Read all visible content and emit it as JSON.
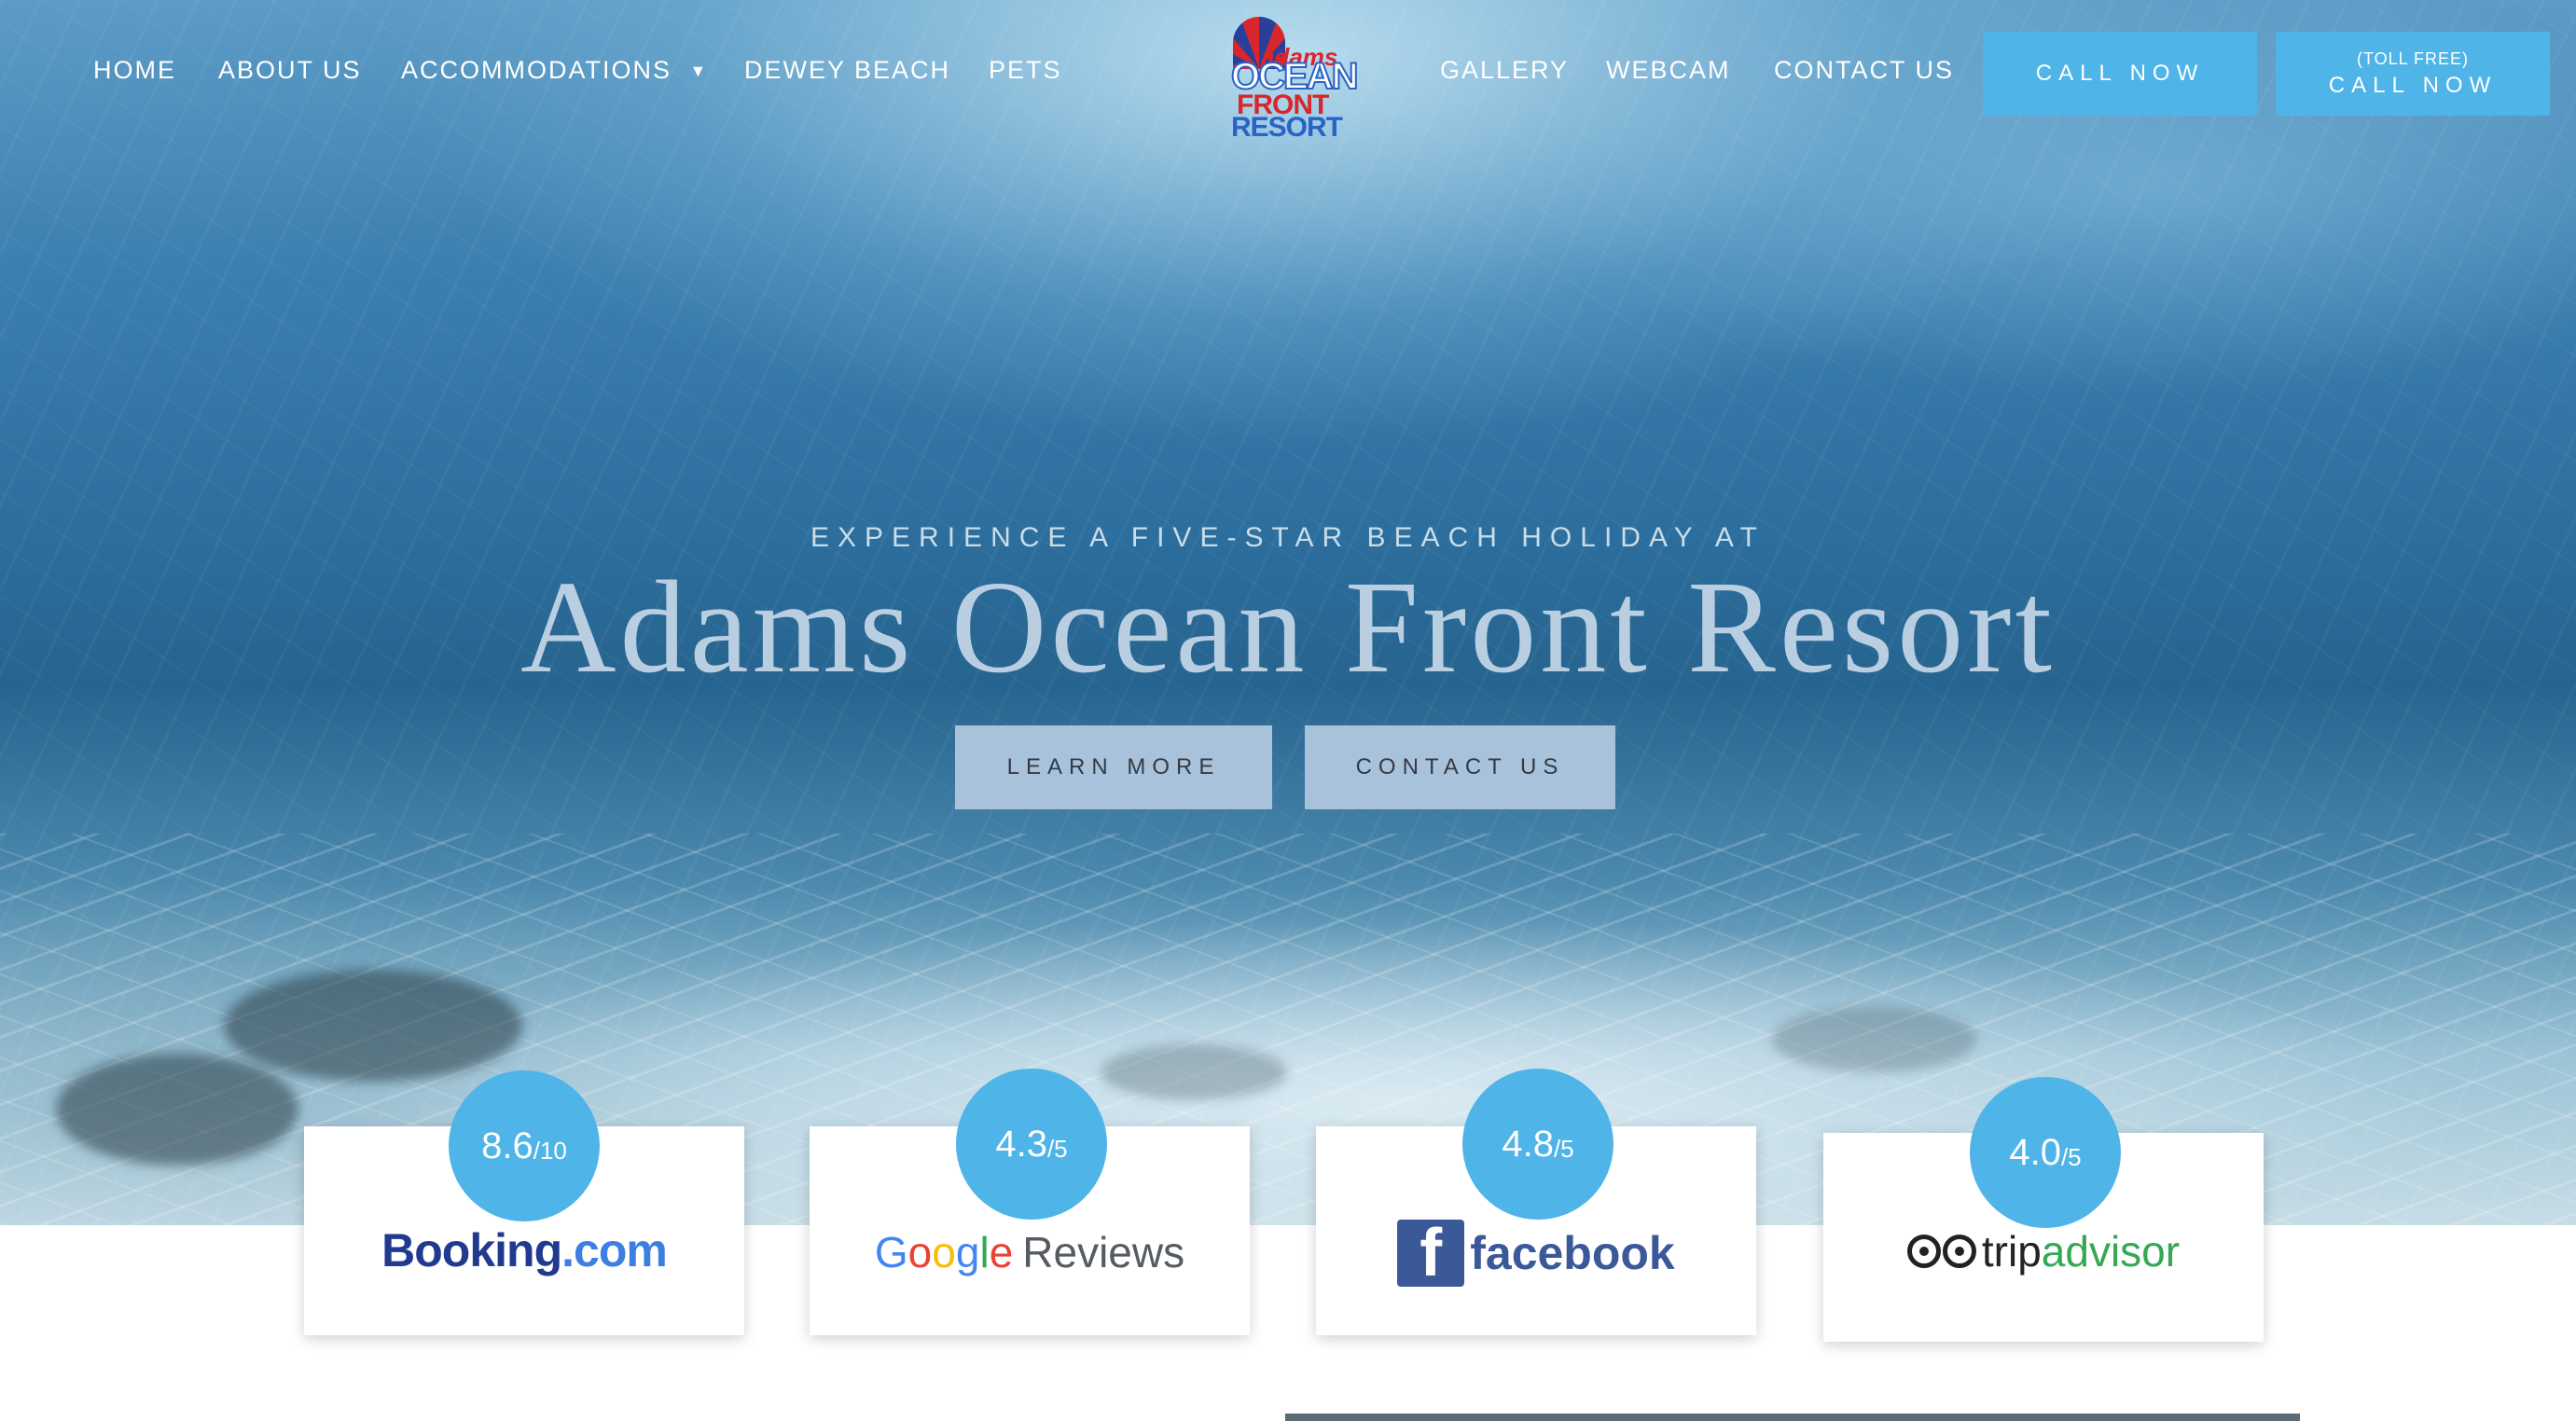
{
  "nav": {
    "left": [
      {
        "label": "HOME"
      },
      {
        "label": "ABOUT US"
      },
      {
        "label": "ACCOMMODATIONS"
      },
      {
        "label": "DEWEY BEACH"
      },
      {
        "label": "PETS"
      }
    ],
    "right": [
      {
        "label": "GALLERY"
      },
      {
        "label": "WEBCAM"
      },
      {
        "label": "CONTACT US"
      }
    ],
    "dropdown_icon": "chevron-down-icon"
  },
  "logo": {
    "line1": "adams",
    "line2": "OCEAN",
    "line3": "FRONT",
    "line4": "RESORT"
  },
  "call_buttons": {
    "primary": "CALL NOW",
    "toll_free_note": "(TOLL FREE)",
    "toll_free": "CALL NOW"
  },
  "hero": {
    "eyebrow": "EXPERIENCE A FIVE-STAR BEACH HOLIDAY AT",
    "headline": "Adams Ocean Front Resort",
    "learn_more": "LEARN MORE",
    "contact_us": "CONTACT US"
  },
  "ratings": [
    {
      "score": "8.6",
      "scale": "/10",
      "brand_a": "Booking",
      "brand_b": ".com"
    },
    {
      "score": "4.3",
      "scale": "/5",
      "brand": "Google",
      "brand_suffix": "Reviews"
    },
    {
      "score": "4.8",
      "scale": "/5",
      "brand": "facebook"
    },
    {
      "score": "4.0",
      "scale": "/5",
      "brand_a": "trip",
      "brand_b": "advisor"
    }
  ],
  "colors": {
    "accent": "#4fb4e8",
    "cta": "#a9c2db",
    "booking_dark": "#213a8f",
    "facebook": "#3b5998"
  }
}
